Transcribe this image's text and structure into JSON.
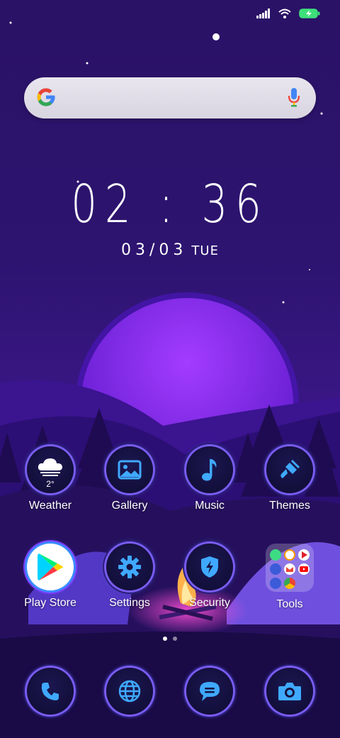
{
  "status": {
    "signal_icon": "signal-icon",
    "wifi_icon": "wifi-icon",
    "battery_icon": "battery-charging-icon"
  },
  "search": {
    "logo": "google-g-icon",
    "mic": "mic-icon"
  },
  "clock": {
    "time": "02 : 36",
    "date": "03/03",
    "weekday": "TUE"
  },
  "weather": {
    "temp": "2°"
  },
  "apps_row1": [
    {
      "label": "Weather",
      "icon": "cloud-icon"
    },
    {
      "label": "Gallery",
      "icon": "image-icon"
    },
    {
      "label": "Music",
      "icon": "music-note-icon"
    },
    {
      "label": "Themes",
      "icon": "paintbrush-icon"
    }
  ],
  "apps_row2": [
    {
      "label": "Play Store",
      "icon": "play-store-icon"
    },
    {
      "label": "Settings",
      "icon": "gear-icon"
    },
    {
      "label": "Security",
      "icon": "shield-bolt-icon"
    },
    {
      "label": "Tools",
      "icon": "folder-icon"
    }
  ],
  "dock": [
    {
      "icon": "phone-icon"
    },
    {
      "icon": "globe-icon"
    },
    {
      "icon": "message-icon"
    },
    {
      "icon": "camera-icon"
    }
  ],
  "page_indicator": {
    "pages": 2,
    "current": 1
  },
  "colors": {
    "accent": "#7a5cf0",
    "icon_blue": "#3fa9ff",
    "background": "#2a1266"
  }
}
